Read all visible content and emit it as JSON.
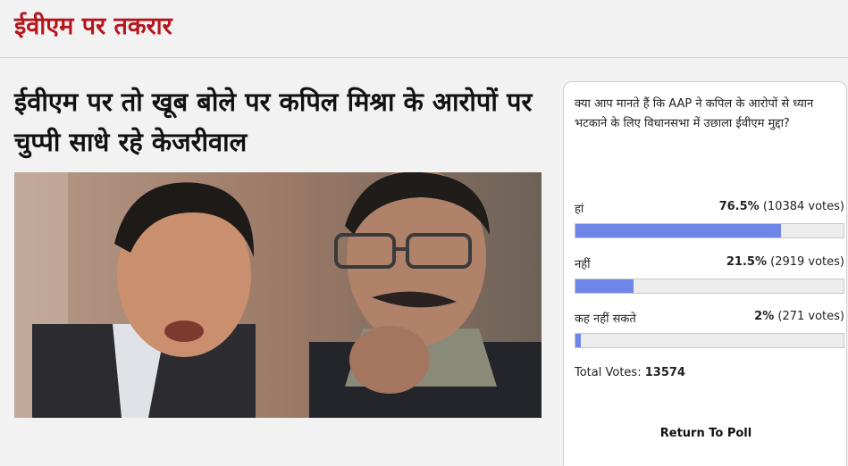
{
  "header": {
    "section_title": "ईवीएम पर तकरार"
  },
  "article": {
    "headline": "ईवीएम पर तो खूब बोले पर कपिल मिश्रा के आरोपों पर चुप्पी साधे रहे केजरीवाल"
  },
  "poll": {
    "question": "क्या आप मानते हैं कि AAP ने कपिल के आरोपों से ध्यान भटकाने के लिए विधानसभा में उछाला ईवीएम मुद्दा?",
    "options": [
      {
        "label": "हां",
        "percent": "76.5%",
        "votes": "(10384 votes)",
        "fraction": 0.765
      },
      {
        "label": "नहीं",
        "percent": "21.5%",
        "votes": "(2919 votes)",
        "fraction": 0.215
      },
      {
        "label": "कह नहीं सकते",
        "percent": "2%",
        "votes": "(271 votes)",
        "fraction": 0.02
      }
    ],
    "total_label": "Total Votes:",
    "total_value": "13574",
    "return_label": "Return To Poll",
    "bar_color": "#6e86e8"
  }
}
